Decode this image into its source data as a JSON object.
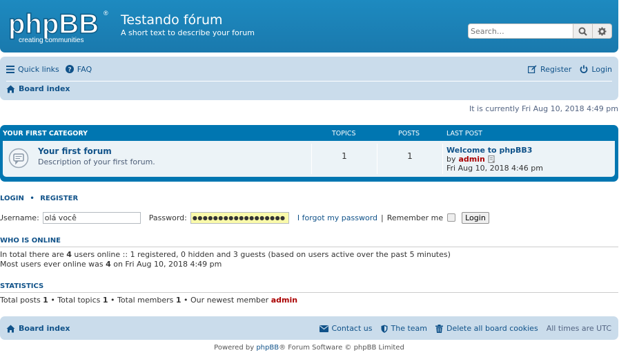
{
  "header": {
    "logo_text": "phpBB",
    "logo_tagline": "creating communities",
    "site_title": "Testando fórum",
    "site_description": "A short text to describe your forum",
    "search_placeholder": "Search…"
  },
  "nav": {
    "quick_links": "Quick links",
    "faq": "FAQ",
    "register": "Register",
    "login": "Login",
    "board_index": "Board index"
  },
  "current_time": "It is currently Fri Aug 10, 2018 4:49 pm",
  "forum_table": {
    "category": "YOUR FIRST CATEGORY",
    "col_topics": "TOPICS",
    "col_posts": "POSTS",
    "col_last_post": "LAST POST",
    "forum": {
      "title": "Your first forum",
      "description": "Description of your first forum.",
      "topics": "1",
      "posts": "1",
      "last_post_title": "Welcome to phpBB3",
      "last_post_by": "by",
      "last_post_author": "admin",
      "last_post_date": "Fri Aug 10, 2018 4:46 pm"
    }
  },
  "login_box": {
    "heading_login": "LOGIN",
    "bullet": "•",
    "heading_register": "REGISTER",
    "username_label": "Username:",
    "username_value": "olá você",
    "password_label": "Password:",
    "password_mask": "●●●●●●●●●●●●●●●●●●",
    "forgot": "I forgot my password",
    "separator": "|",
    "remember_me": "Remember me",
    "login_button": "Login"
  },
  "who_is_online": {
    "heading": "WHO IS ONLINE",
    "line1_pre": "In total there are ",
    "line1_count": "4",
    "line1_post": " users online :: 1 registered, 0 hidden and 3 guests (based on users active over the past 5 minutes)",
    "line2_pre": "Most users ever online was ",
    "line2_count": "4",
    "line2_post": " on Fri Aug 10, 2018 4:49 pm"
  },
  "statistics": {
    "heading": "STATISTICS",
    "posts_label": "Total posts ",
    "posts": "1",
    "topics_label": " • Total topics ",
    "topics": "1",
    "members_label": " • Total members ",
    "members": "1",
    "newest_label": " • Our newest member ",
    "newest": "admin"
  },
  "footer": {
    "board_index": "Board index",
    "contact": "Contact us",
    "team": "The team",
    "delete_cookies": "Delete all board cookies",
    "timezone": "All times are UTC",
    "powered_pre": "Powered by ",
    "powered_link": "phpBB",
    "powered_post": "® Forum Software © phpBB Limited"
  },
  "colors": {
    "header_blue": "#1a79ad",
    "navbar_bg": "#cadceb",
    "forum_box": "#0076b1",
    "row_bg": "#ecf3f7",
    "link": "#105289",
    "admin_red": "#aa0000",
    "password_bg": "#fafaaa"
  }
}
